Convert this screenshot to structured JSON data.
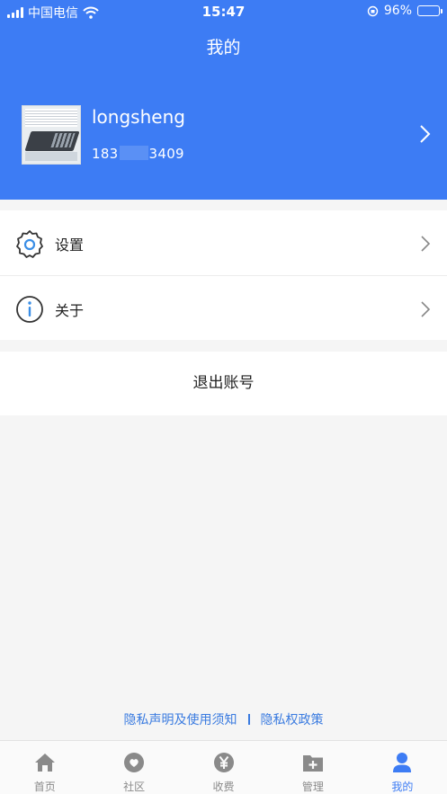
{
  "status_bar": {
    "carrier": "中国电信",
    "time": "15:47",
    "battery_percent": "96%",
    "battery_level": 0.96
  },
  "header": {
    "title": "我的"
  },
  "profile": {
    "username": "longsheng",
    "phone_prefix": "183",
    "phone_suffix": "3409"
  },
  "menu": {
    "items": [
      {
        "label": "设置",
        "icon": "gear-icon"
      },
      {
        "label": "关于",
        "icon": "info-icon"
      }
    ]
  },
  "logout": {
    "label": "退出账号"
  },
  "policy": {
    "privacy_statement": "隐私声明及使用须知",
    "privacy_policy": "隐私权政策"
  },
  "tabbar": {
    "items": [
      {
        "label": "首页",
        "icon": "home-icon"
      },
      {
        "label": "社区",
        "icon": "community-icon"
      },
      {
        "label": "收费",
        "icon": "yen-icon"
      },
      {
        "label": "管理",
        "icon": "folder-plus-icon"
      },
      {
        "label": "我的",
        "icon": "user-icon"
      }
    ],
    "active_index": 4
  },
  "colors": {
    "primary": "#3d7cf4",
    "link": "#3a7be0",
    "tab_inactive": "#8a8a8a",
    "background": "#f5f5f5"
  }
}
